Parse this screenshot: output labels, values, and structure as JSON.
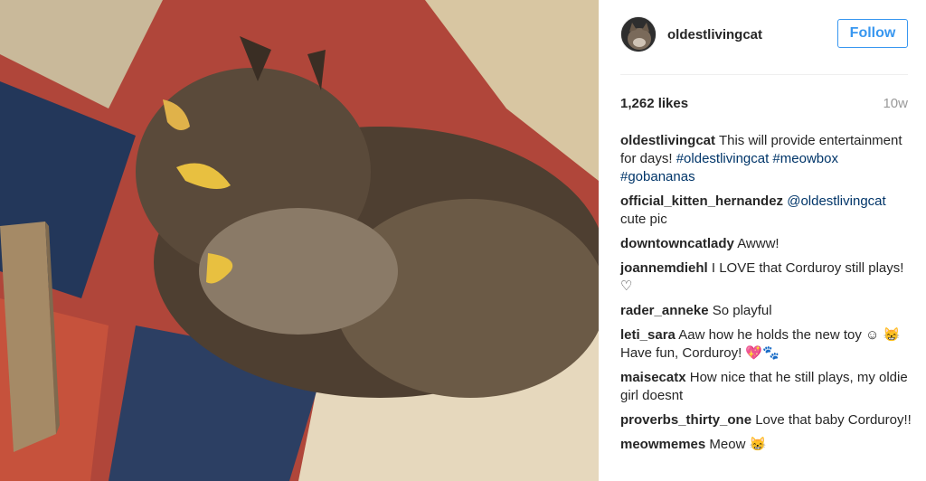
{
  "post": {
    "username": "oldestlivingcat",
    "follow_label": "Follow",
    "likes": "1,262 likes",
    "time": "10w",
    "comments": [
      {
        "user": "oldestlivingcat",
        "text": "This will provide entertainment for days!",
        "tags": "#oldestlivingcat #meowbox #gobananas"
      },
      {
        "user": "official_kitten_hernandez",
        "mention": "@oldestlivingcat",
        "text": "cute pic"
      },
      {
        "user": "downtowncatlady",
        "text": "Awww!"
      },
      {
        "user": "joannemdiehl",
        "text": "I LOVE that Corduroy still plays! ♡"
      },
      {
        "user": "rader_anneke",
        "text": "So playful"
      },
      {
        "user": "leti_sara",
        "text": "Aaw how he holds the new toy ☺ 😸 Have fun, Corduroy! 💖🐾"
      },
      {
        "user": "maisecatx",
        "text": "How nice that he still plays, my oldie girl doesnt"
      },
      {
        "user": "proverbs_thirty_one",
        "text": "Love that baby Corduroy!!"
      },
      {
        "user": "meowmemes",
        "text": "Meow 😸"
      }
    ]
  },
  "colors": {
    "link": "#003569",
    "accent": "#3897f0",
    "muted": "#999999"
  }
}
